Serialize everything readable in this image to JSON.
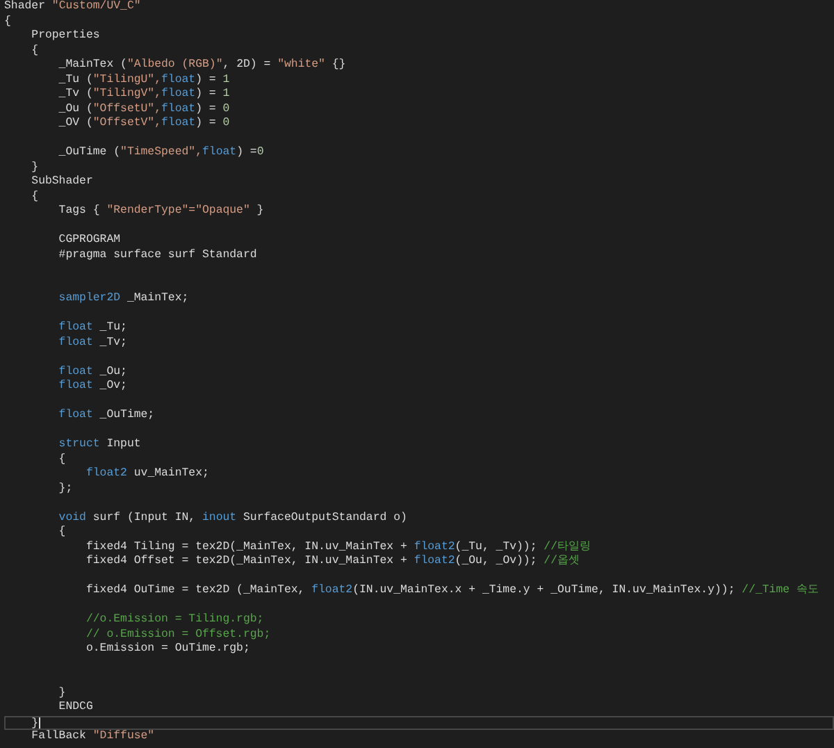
{
  "editor": {
    "lines": [
      {
        "current": false,
        "segments": [
          {
            "kind": "plain",
            "text": "Shader "
          },
          {
            "kind": "str",
            "text": "\"Custom/UV_C\""
          }
        ]
      },
      {
        "current": false,
        "segments": [
          {
            "kind": "plain",
            "text": "{"
          }
        ]
      },
      {
        "current": false,
        "segments": [
          {
            "kind": "plain",
            "text": "    Properties"
          }
        ]
      },
      {
        "current": false,
        "segments": [
          {
            "kind": "plain",
            "text": "    {"
          }
        ]
      },
      {
        "current": false,
        "segments": [
          {
            "kind": "plain",
            "text": "        _MainTex ("
          },
          {
            "kind": "str",
            "text": "\"Albedo (RGB)\""
          },
          {
            "kind": "plain",
            "text": ", 2D) = "
          },
          {
            "kind": "str",
            "text": "\"white\""
          },
          {
            "kind": "plain",
            "text": " {}"
          }
        ]
      },
      {
        "current": false,
        "segments": [
          {
            "kind": "plain",
            "text": "        _Tu ("
          },
          {
            "kind": "str",
            "text": "\"TilingU\","
          },
          {
            "kind": "kw",
            "text": "float"
          },
          {
            "kind": "plain",
            "text": ") = "
          },
          {
            "kind": "num",
            "text": "1"
          }
        ]
      },
      {
        "current": false,
        "segments": [
          {
            "kind": "plain",
            "text": "        _Tv ("
          },
          {
            "kind": "str",
            "text": "\"TilingV\","
          },
          {
            "kind": "kw",
            "text": "float"
          },
          {
            "kind": "plain",
            "text": ") = "
          },
          {
            "kind": "num",
            "text": "1"
          }
        ]
      },
      {
        "current": false,
        "segments": [
          {
            "kind": "plain",
            "text": "        _Ou ("
          },
          {
            "kind": "str",
            "text": "\"OffsetU\","
          },
          {
            "kind": "kw",
            "text": "float"
          },
          {
            "kind": "plain",
            "text": ") = "
          },
          {
            "kind": "num",
            "text": "0"
          }
        ]
      },
      {
        "current": false,
        "segments": [
          {
            "kind": "plain",
            "text": "        _OV ("
          },
          {
            "kind": "str",
            "text": "\"OffsetV\","
          },
          {
            "kind": "kw",
            "text": "float"
          },
          {
            "kind": "plain",
            "text": ") = "
          },
          {
            "kind": "num",
            "text": "0"
          }
        ]
      },
      {
        "current": false
      },
      {
        "current": false,
        "segments": [
          {
            "kind": "plain",
            "text": "        _OuTime ("
          },
          {
            "kind": "str",
            "text": "\"TimeSpeed\","
          },
          {
            "kind": "kw",
            "text": "float"
          },
          {
            "kind": "plain",
            "text": ") ="
          },
          {
            "kind": "num",
            "text": "0"
          }
        ]
      },
      {
        "current": false,
        "segments": [
          {
            "kind": "plain",
            "text": "    }"
          }
        ]
      },
      {
        "current": false,
        "segments": [
          {
            "kind": "plain",
            "text": "    SubShader"
          }
        ]
      },
      {
        "current": false,
        "segments": [
          {
            "kind": "plain",
            "text": "    {"
          }
        ]
      },
      {
        "current": false,
        "segments": [
          {
            "kind": "plain",
            "text": "        Tags { "
          },
          {
            "kind": "str",
            "text": "\"RenderType\"=\"Opaque\""
          },
          {
            "kind": "plain",
            "text": " }"
          }
        ]
      },
      {
        "current": false
      },
      {
        "current": false,
        "segments": [
          {
            "kind": "plain",
            "text": "        CGPROGRAM"
          }
        ]
      },
      {
        "current": false,
        "segments": [
          {
            "kind": "plain",
            "text": "        #pragma surface surf Standard"
          }
        ]
      },
      {
        "current": false
      },
      {
        "current": false
      },
      {
        "current": false,
        "segments": [
          {
            "kind": "kw",
            "text": "        sampler2D"
          },
          {
            "kind": "plain",
            "text": " _MainTex;"
          }
        ]
      },
      {
        "current": false
      },
      {
        "current": false,
        "segments": [
          {
            "kind": "kw",
            "text": "        float"
          },
          {
            "kind": "plain",
            "text": " _Tu;"
          }
        ]
      },
      {
        "current": false,
        "segments": [
          {
            "kind": "kw",
            "text": "        float"
          },
          {
            "kind": "plain",
            "text": " _Tv;"
          }
        ]
      },
      {
        "current": false
      },
      {
        "current": false,
        "segments": [
          {
            "kind": "kw",
            "text": "        float"
          },
          {
            "kind": "plain",
            "text": " _Ou;"
          }
        ]
      },
      {
        "current": false,
        "segments": [
          {
            "kind": "kw",
            "text": "        float"
          },
          {
            "kind": "plain",
            "text": " _Ov;"
          }
        ]
      },
      {
        "current": false
      },
      {
        "current": false,
        "segments": [
          {
            "kind": "kw",
            "text": "        float"
          },
          {
            "kind": "plain",
            "text": " _OuTime;"
          }
        ]
      },
      {
        "current": false
      },
      {
        "current": false,
        "segments": [
          {
            "kind": "kw",
            "text": "        struct"
          },
          {
            "kind": "plain",
            "text": " Input"
          }
        ]
      },
      {
        "current": false,
        "segments": [
          {
            "kind": "plain",
            "text": "        {"
          }
        ]
      },
      {
        "current": false,
        "segments": [
          {
            "kind": "kw",
            "text": "            float2"
          },
          {
            "kind": "plain",
            "text": " uv_MainTex;"
          }
        ]
      },
      {
        "current": false,
        "segments": [
          {
            "kind": "plain",
            "text": "        };"
          }
        ]
      },
      {
        "current": false
      },
      {
        "current": false,
        "segments": [
          {
            "kind": "kw",
            "text": "        void"
          },
          {
            "kind": "plain",
            "text": " surf (Input IN, "
          },
          {
            "kind": "kw",
            "text": "inout"
          },
          {
            "kind": "plain",
            "text": " SurfaceOutputStandard o)"
          }
        ]
      },
      {
        "current": false,
        "segments": [
          {
            "kind": "plain",
            "text": "        {"
          }
        ]
      },
      {
        "current": false,
        "segments": [
          {
            "kind": "plain",
            "text": "            fixed4 Tiling = tex2D(_MainTex, IN.uv_MainTex + "
          },
          {
            "kind": "kw",
            "text": "float2"
          },
          {
            "kind": "plain",
            "text": "(_Tu, _Tv)); "
          },
          {
            "kind": "comment",
            "text": "//타일링"
          }
        ]
      },
      {
        "current": false,
        "segments": [
          {
            "kind": "plain",
            "text": "            fixed4 Offset = tex2D(_MainTex, IN.uv_MainTex + "
          },
          {
            "kind": "kw",
            "text": "float2"
          },
          {
            "kind": "plain",
            "text": "(_Ou, _Ov)); "
          },
          {
            "kind": "comment",
            "text": "//옵셋"
          }
        ]
      },
      {
        "current": false
      },
      {
        "current": false,
        "segments": [
          {
            "kind": "plain",
            "text": "            fixed4 OuTime = tex2D (_MainTex, "
          },
          {
            "kind": "kw",
            "text": "float2"
          },
          {
            "kind": "plain",
            "text": "(IN.uv_MainTex.x + _Time.y + _OuTime, IN.uv_MainTex.y)); "
          },
          {
            "kind": "comment",
            "text": "//_Time 속도"
          }
        ]
      },
      {
        "current": false
      },
      {
        "current": false,
        "segments": [
          {
            "kind": "comment",
            "text": "            //o.Emission = Tiling.rgb;"
          }
        ]
      },
      {
        "current": false,
        "segments": [
          {
            "kind": "comment",
            "text": "            // o.Emission = Offset.rgb;"
          }
        ]
      },
      {
        "current": false,
        "segments": [
          {
            "kind": "plain",
            "text": "            o.Emission = OuTime.rgb;"
          }
        ]
      },
      {
        "current": false
      },
      {
        "current": false
      },
      {
        "current": false,
        "segments": [
          {
            "kind": "plain",
            "text": "        }"
          }
        ]
      },
      {
        "current": false,
        "segments": [
          {
            "kind": "plain",
            "text": "        ENDCG"
          }
        ]
      },
      {
        "current": true,
        "segments": [
          {
            "kind": "plain",
            "text": "    }"
          }
        ]
      },
      {
        "current": false,
        "segments": [
          {
            "kind": "plain",
            "text": "    FallBack "
          },
          {
            "kind": "str",
            "text": "\"Diffuse\""
          }
        ]
      }
    ]
  }
}
